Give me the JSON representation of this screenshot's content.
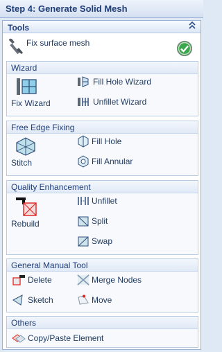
{
  "window": {
    "title": "Step 4: Generate Solid Mesh"
  },
  "tools": {
    "header": "Tools",
    "fix_surface_mesh": "Fix surface mesh"
  },
  "groups": {
    "wizard": {
      "title": "Wizard",
      "fix_wizard": "Fix Wizard",
      "fill_hole_wizard": "Fill Hole Wizard",
      "unfillet_wizard": "Unfillet Wizard"
    },
    "free_edge": {
      "title": "Free Edge Fixing",
      "stitch": "Stitch",
      "fill_hole": "Fill Hole",
      "fill_annular": "Fill Annular"
    },
    "quality": {
      "title": "Quality Enhancement",
      "rebuild": "Rebuild",
      "unfillet": "Unfillet",
      "split": "Split",
      "swap": "Swap"
    },
    "manual": {
      "title": "General Manual Tool",
      "delete": "Delete",
      "merge_nodes": "Merge Nodes",
      "sketch": "Sketch",
      "move": "Move"
    },
    "others": {
      "title": "Others",
      "copy_paste": "Copy/Paste Element"
    }
  },
  "icons": {
    "collapse": "double-chevron-up-icon",
    "wrench": "wrench-icon",
    "status": "green-check-icon"
  },
  "colors": {
    "title_text": "#1f3d78",
    "panel_bg": "#eef3fa",
    "check_green": "#3aa84a"
  }
}
